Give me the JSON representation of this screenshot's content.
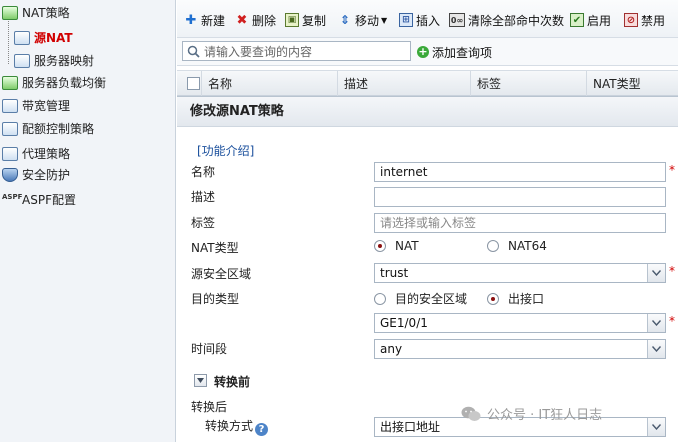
{
  "sidebar": {
    "items": [
      {
        "label": "NAT策略",
        "icon": "nat-policy-icon",
        "level": 0
      },
      {
        "label": "源NAT",
        "icon": "source-nat-icon",
        "level": 1,
        "active": true
      },
      {
        "label": "服务器映射",
        "icon": "server-mapping-icon",
        "level": 1
      },
      {
        "label": "服务器负载均衡",
        "icon": "server-load-balancing-icon",
        "level": 0
      },
      {
        "label": "带宽管理",
        "icon": "bandwidth-icon",
        "level": 0
      },
      {
        "label": "配额控制策略",
        "icon": "quota-icon",
        "level": 0
      },
      {
        "label": "代理策略",
        "icon": "proxy-icon",
        "level": 0
      },
      {
        "label": "安全防护",
        "icon": "shield-icon",
        "level": 0
      },
      {
        "label": "ASPF配置",
        "icon": "aspf-icon",
        "level": 0
      }
    ],
    "aspf_icon_text": "ASPF"
  },
  "toolbar": {
    "new": "新建",
    "delete": "删除",
    "copy": "复制",
    "move": "移动",
    "insert": "插入",
    "clear_hits": "清除全部命中次数",
    "enable": "启用",
    "disable": "禁用"
  },
  "search": {
    "placeholder": "请输入要查询的内容",
    "add_query": "添加查询项"
  },
  "table": {
    "columns": [
      "名称",
      "描述",
      "标签",
      "NAT类型"
    ]
  },
  "dialog": {
    "title": "修改源NAT策略",
    "intro_link": "[功能介绍]",
    "fields": {
      "name_label": "名称",
      "name_value": "internet",
      "desc_label": "描述",
      "desc_value": "",
      "tag_label": "标签",
      "tag_placeholder": "请选择或输入标签",
      "nat_type_label": "NAT类型",
      "nat_type_options": [
        "NAT",
        "NAT64"
      ],
      "nat_type_selected": "NAT",
      "src_zone_label": "源安全区域",
      "src_zone_value": "trust",
      "dst_type_label": "目的类型",
      "dst_type_options": [
        "目的安全区域",
        "出接口"
      ],
      "dst_type_selected": "出接口",
      "out_interface_value": "GE1/0/1",
      "time_range_label": "时间段",
      "time_range_value": "any",
      "before_section": "转换前",
      "after_label": "转换后",
      "mode_label": "转换方式",
      "mode_value": "出接口地址"
    },
    "required_mark": "*"
  },
  "watermark": "公众号 · IT狂人日志",
  "colors": {
    "active_nav": "#d10000",
    "required": "#d10000",
    "link": "#1a4f9c",
    "border": "#a9b6c4"
  }
}
